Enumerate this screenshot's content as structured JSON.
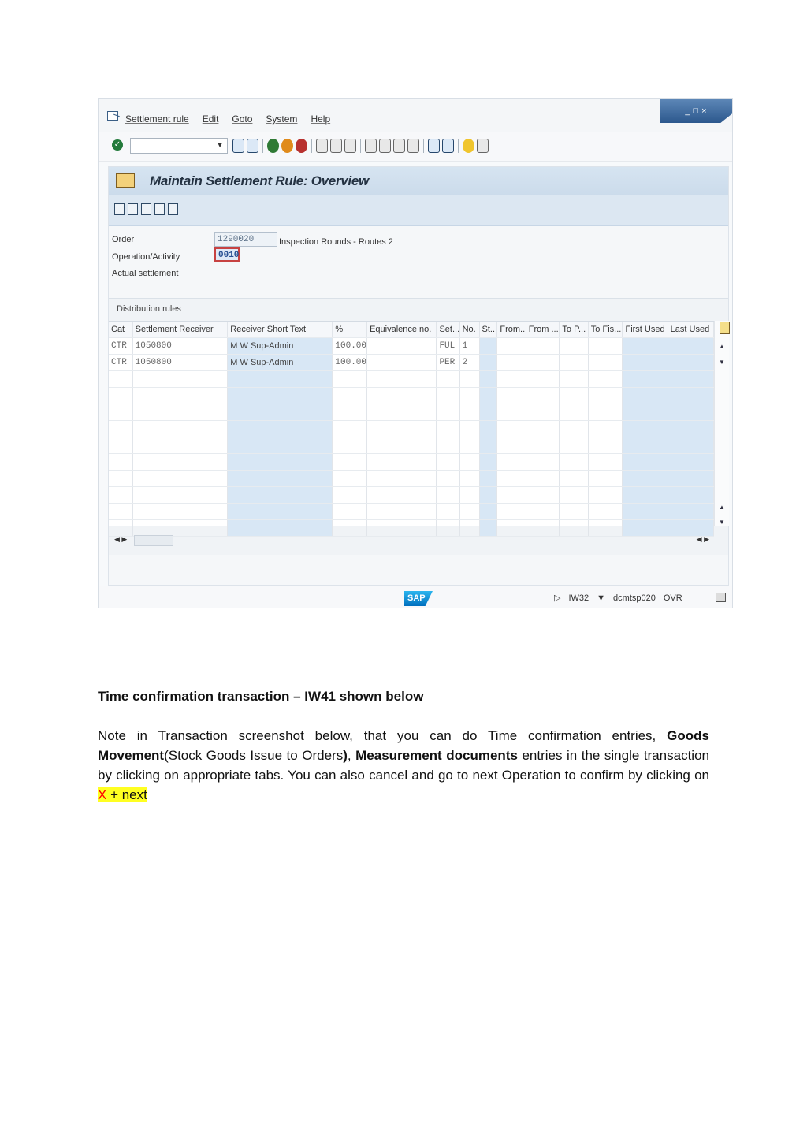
{
  "menu": {
    "items": [
      "Settlement rule",
      "Edit",
      "Goto",
      "System",
      "Help"
    ]
  },
  "window_controls": {
    "minimize": "_",
    "restore": "□",
    "close": "×"
  },
  "toolbar": {
    "icons": [
      "save-icon",
      "back-icon",
      "exit-icon",
      "cancel-icon",
      "print-icon",
      "find-icon",
      "find-next-icon",
      "first-page-icon",
      "previous-page-icon",
      "next-page-icon",
      "last-page-icon",
      "layout-icon",
      "help-icon"
    ]
  },
  "screen": {
    "title": "Maintain Settlement Rule: Overview",
    "order_label": "Order",
    "order_value": "1290020",
    "order_text": "Inspection Rounds - Routes 2",
    "operation_label": "Operation/Activity",
    "operation_value": "0010",
    "actual_settlement_label": "Actual settlement"
  },
  "distribution_rules": {
    "title": "Distribution rules",
    "columns": [
      "Cat",
      "Settlement Receiver",
      "Receiver Short Text",
      "%",
      "Equivalence no.",
      "Set...",
      "No.",
      "St...",
      "From...",
      "From ...",
      "To P...",
      "To Fis...",
      "First Used",
      "Last Used"
    ],
    "rows": [
      [
        "CTR",
        "1050800",
        "M W Sup-Admin",
        "100.00",
        "",
        "FUL",
        "1",
        "",
        "",
        "",
        "",
        "",
        "",
        ""
      ],
      [
        "CTR",
        "1050800",
        "M W Sup-Admin",
        "100.00",
        "",
        "PER",
        "2",
        "",
        "",
        "",
        "",
        "",
        "",
        ""
      ]
    ]
  },
  "status_bar": {
    "transaction": "IW32",
    "server": "dcmtsp020",
    "mode": "OVR",
    "logo": "SAP"
  },
  "document": {
    "heading": "Time confirmation transaction – IW41 shown below",
    "p1": "Note in Transaction screenshot below, that you can do Time confirmation entries, ",
    "p2": "Goods Movement",
    "p3": "(Stock Goods Issue to Orders",
    "p4": ")",
    "p5": ", ",
    "p6": "Measurement documents",
    "p7": " entries in the single transaction by clicking on appropriate tabs. You can also cancel and go to next Operation to confirm by clicking on ",
    "highlight_x": "X",
    "highlight_next": " + next"
  }
}
